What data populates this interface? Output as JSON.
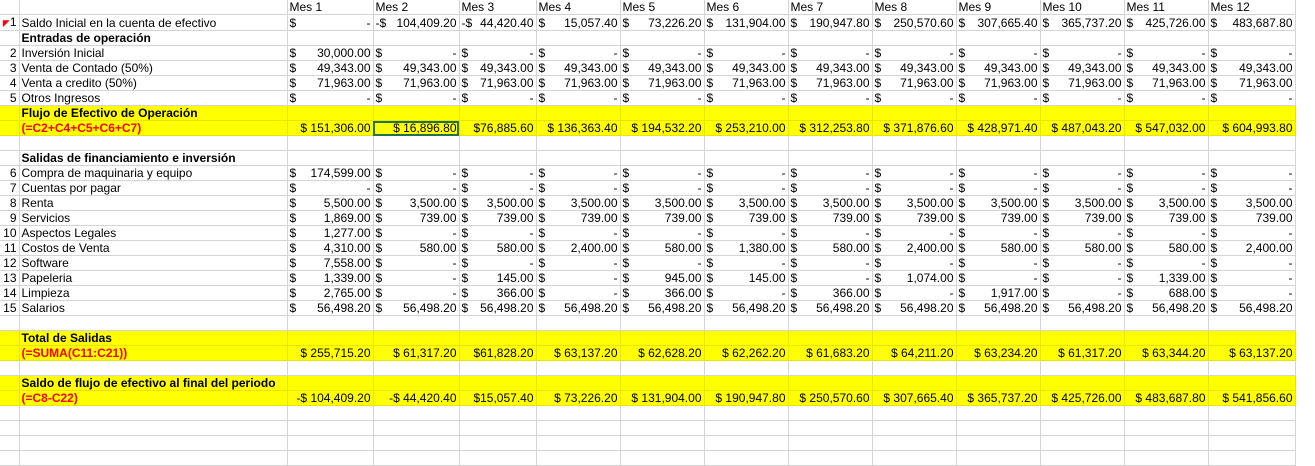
{
  "months": [
    "Mes 1",
    "Mes 2",
    "Mes 3",
    "Mes 4",
    "Mes 5",
    "Mes 6",
    "Mes 7",
    "Mes 8",
    "Mes 9",
    "Mes 10",
    "Mes 11",
    "Mes 12"
  ],
  "rows": [
    {
      "type": "header"
    },
    {
      "type": "data",
      "num": "1",
      "label": "Saldo Inicial en la cuenta de efectivo",
      "cells": [
        [
          "$",
          "-"
        ],
        [
          "-$",
          "104,409.20"
        ],
        [
          "-$",
          "44,420.40"
        ],
        [
          "$",
          "15,057.40"
        ],
        [
          "$",
          "73,226.20"
        ],
        [
          "$",
          "131,904.00"
        ],
        [
          "$",
          "190,947.80"
        ],
        [
          "$",
          "250,570.60"
        ],
        [
          "$",
          "307,665.40"
        ],
        [
          "$",
          "365,737.20"
        ],
        [
          "$",
          "425,726.00"
        ],
        [
          "$",
          "483,687.80"
        ]
      ]
    },
    {
      "type": "section",
      "label": "Entradas de operación"
    },
    {
      "type": "data",
      "num": "2",
      "label": "Inversión Inicial",
      "cells": [
        [
          "$",
          "30,000.00"
        ],
        [
          "$",
          "-"
        ],
        [
          "$",
          "-"
        ],
        [
          "$",
          "-"
        ],
        [
          "$",
          "-"
        ],
        [
          "$",
          "-"
        ],
        [
          "$",
          "-"
        ],
        [
          "$",
          "-"
        ],
        [
          "$",
          "-"
        ],
        [
          "$",
          "-"
        ],
        [
          "$",
          "-"
        ],
        [
          "$",
          "-"
        ]
      ]
    },
    {
      "type": "data",
      "num": "3",
      "label": "Venta de Contado (50%)",
      "cells": [
        [
          "$",
          "49,343.00"
        ],
        [
          "$",
          "49,343.00"
        ],
        [
          "$",
          "49,343.00"
        ],
        [
          "$",
          "49,343.00"
        ],
        [
          "$",
          "49,343.00"
        ],
        [
          "$",
          "49,343.00"
        ],
        [
          "$",
          "49,343.00"
        ],
        [
          "$",
          "49,343.00"
        ],
        [
          "$",
          "49,343.00"
        ],
        [
          "$",
          "49,343.00"
        ],
        [
          "$",
          "49,343.00"
        ],
        [
          "$",
          "49,343.00"
        ]
      ]
    },
    {
      "type": "data",
      "num": "4",
      "label": "Venta a credito (50%)",
      "cells": [
        [
          "$",
          "71,963.00"
        ],
        [
          "$",
          "71,963.00"
        ],
        [
          "$",
          "71,963.00"
        ],
        [
          "$",
          "71,963.00"
        ],
        [
          "$",
          "71,963.00"
        ],
        [
          "$",
          "71,963.00"
        ],
        [
          "$",
          "71,963.00"
        ],
        [
          "$",
          "71,963.00"
        ],
        [
          "$",
          "71,963.00"
        ],
        [
          "$",
          "71,963.00"
        ],
        [
          "$",
          "71,963.00"
        ],
        [
          "$",
          "71,963.00"
        ]
      ]
    },
    {
      "type": "data",
      "num": "5",
      "label": "Otros Ingresos",
      "cells": [
        [
          "$",
          "-"
        ],
        [
          "$",
          "-"
        ],
        [
          "$",
          "-"
        ],
        [
          "$",
          "-"
        ],
        [
          "$",
          "-"
        ],
        [
          "$",
          "-"
        ],
        [
          "$",
          "-"
        ],
        [
          "$",
          "-"
        ],
        [
          "$",
          "-"
        ],
        [
          "$",
          "-"
        ],
        [
          "$",
          "-"
        ],
        [
          "$",
          "-"
        ]
      ]
    },
    {
      "type": "hl1",
      "label": "Flujo de Efectivo de Operación"
    },
    {
      "type": "hl2",
      "label": "(=C2+C4+C5+C6+C7)",
      "cells": [
        "$ 151,306.00",
        "$   16,896.80",
        "$76,885.60",
        "$ 136,363.40",
        "$ 194,532.20",
        "$ 253,210.00",
        "$ 312,253.80",
        "$ 371,876.60",
        "$ 428,971.40",
        "$ 487,043.20",
        "$ 547,032.00",
        "$ 604,993.80"
      ]
    },
    {
      "type": "blank"
    },
    {
      "type": "section",
      "label": "Salidas de financiamiento e inversión"
    },
    {
      "type": "data",
      "num": "6",
      "label": "Compra de maquinaria y equipo",
      "cells": [
        [
          "$",
          "174,599.00"
        ],
        [
          "$",
          "-"
        ],
        [
          "$",
          "-"
        ],
        [
          "$",
          "-"
        ],
        [
          "$",
          "-"
        ],
        [
          "$",
          "-"
        ],
        [
          "$",
          "-"
        ],
        [
          "$",
          "-"
        ],
        [
          "$",
          "-"
        ],
        [
          "$",
          "-"
        ],
        [
          "$",
          "-"
        ],
        [
          "$",
          "-"
        ]
      ]
    },
    {
      "type": "data",
      "num": "7",
      "label": "Cuentas por pagar",
      "cells": [
        [
          "$",
          "-"
        ],
        [
          "$",
          "-"
        ],
        [
          "$",
          "-"
        ],
        [
          "$",
          "-"
        ],
        [
          "$",
          "-"
        ],
        [
          "$",
          "-"
        ],
        [
          "$",
          "-"
        ],
        [
          "$",
          "-"
        ],
        [
          "$",
          "-"
        ],
        [
          "$",
          "-"
        ],
        [
          "$",
          "-"
        ],
        [
          "$",
          "-"
        ]
      ]
    },
    {
      "type": "data",
      "num": "8",
      "label": "Renta",
      "cells": [
        [
          "$",
          "5,500.00"
        ],
        [
          "$",
          "3,500.00"
        ],
        [
          "$",
          "3,500.00"
        ],
        [
          "$",
          "3,500.00"
        ],
        [
          "$",
          "3,500.00"
        ],
        [
          "$",
          "3,500.00"
        ],
        [
          "$",
          "3,500.00"
        ],
        [
          "$",
          "3,500.00"
        ],
        [
          "$",
          "3,500.00"
        ],
        [
          "$",
          "3,500.00"
        ],
        [
          "$",
          "3,500.00"
        ],
        [
          "$",
          "3,500.00"
        ]
      ]
    },
    {
      "type": "data",
      "num": "9",
      "label": "Servicios",
      "cells": [
        [
          "$",
          "1,869.00"
        ],
        [
          "$",
          "739.00"
        ],
        [
          "$",
          "739.00"
        ],
        [
          "$",
          "739.00"
        ],
        [
          "$",
          "739.00"
        ],
        [
          "$",
          "739.00"
        ],
        [
          "$",
          "739.00"
        ],
        [
          "$",
          "739.00"
        ],
        [
          "$",
          "739.00"
        ],
        [
          "$",
          "739.00"
        ],
        [
          "$",
          "739.00"
        ],
        [
          "$",
          "739.00"
        ]
      ]
    },
    {
      "type": "data",
      "num": "10",
      "label": "Aspectos Legales",
      "cells": [
        [
          "$",
          "1,277.00"
        ],
        [
          "$",
          "-"
        ],
        [
          "$",
          "-"
        ],
        [
          "$",
          "-"
        ],
        [
          "$",
          "-"
        ],
        [
          "$",
          "-"
        ],
        [
          "$",
          "-"
        ],
        [
          "$",
          "-"
        ],
        [
          "$",
          "-"
        ],
        [
          "$",
          "-"
        ],
        [
          "$",
          "-"
        ],
        [
          "$",
          "-"
        ]
      ]
    },
    {
      "type": "data",
      "num": "11",
      "label": "Costos de Venta",
      "cells": [
        [
          "$",
          "4,310.00"
        ],
        [
          "$",
          "580.00"
        ],
        [
          "$",
          "580.00"
        ],
        [
          "$",
          "2,400.00"
        ],
        [
          "$",
          "580.00"
        ],
        [
          "$",
          "1,380.00"
        ],
        [
          "$",
          "580.00"
        ],
        [
          "$",
          "2,400.00"
        ],
        [
          "$",
          "580.00"
        ],
        [
          "$",
          "580.00"
        ],
        [
          "$",
          "580.00"
        ],
        [
          "$",
          "2,400.00"
        ]
      ]
    },
    {
      "type": "data",
      "num": "12",
      "label": "Software",
      "cells": [
        [
          "$",
          "7,558.00"
        ],
        [
          "$",
          "-"
        ],
        [
          "$",
          "-"
        ],
        [
          "$",
          "-"
        ],
        [
          "$",
          "-"
        ],
        [
          "$",
          "-"
        ],
        [
          "$",
          "-"
        ],
        [
          "$",
          "-"
        ],
        [
          "$",
          "-"
        ],
        [
          "$",
          "-"
        ],
        [
          "$",
          "-"
        ],
        [
          "$",
          "-"
        ]
      ]
    },
    {
      "type": "data",
      "num": "13",
      "label": "Papeleria",
      "cells": [
        [
          "$",
          "1,339.00"
        ],
        [
          "$",
          "-"
        ],
        [
          "$",
          "145.00"
        ],
        [
          "$",
          "-"
        ],
        [
          "$",
          "945.00"
        ],
        [
          "$",
          "145.00"
        ],
        [
          "$",
          "-"
        ],
        [
          "$",
          "1,074.00"
        ],
        [
          "$",
          "-"
        ],
        [
          "$",
          "-"
        ],
        [
          "$",
          "1,339.00"
        ],
        [
          "$",
          "-"
        ]
      ]
    },
    {
      "type": "data",
      "num": "14",
      "label": "Limpieza",
      "cells": [
        [
          "$",
          "2,765.00"
        ],
        [
          "$",
          "-"
        ],
        [
          "$",
          "366.00"
        ],
        [
          "$",
          "-"
        ],
        [
          "$",
          "366.00"
        ],
        [
          "$",
          "-"
        ],
        [
          "$",
          "366.00"
        ],
        [
          "$",
          "-"
        ],
        [
          "$",
          "1,917.00"
        ],
        [
          "$",
          "-"
        ],
        [
          "$",
          "688.00"
        ],
        [
          "$",
          "-"
        ]
      ]
    },
    {
      "type": "data",
      "num": "15",
      "label": "Salarios",
      "cells": [
        [
          "$",
          "56,498.20"
        ],
        [
          "$",
          "56,498.20"
        ],
        [
          "$",
          "56,498.20"
        ],
        [
          "$",
          "56,498.20"
        ],
        [
          "$",
          "56,498.20"
        ],
        [
          "$",
          "56,498.20"
        ],
        [
          "$",
          "56,498.20"
        ],
        [
          "$",
          "56,498.20"
        ],
        [
          "$",
          "56,498.20"
        ],
        [
          "$",
          "56,498.20"
        ],
        [
          "$",
          "56,498.20"
        ],
        [
          "$",
          "56,498.20"
        ]
      ]
    },
    {
      "type": "blank"
    },
    {
      "type": "hl1",
      "label": "Total de Salidas"
    },
    {
      "type": "hl2",
      "label": "(=SUMA(C11:C21))",
      "cells": [
        "$ 255,715.20",
        "$   61,317.20",
        "$61,828.20",
        "$   63,137.20",
        "$   62,628.20",
        "$   62,262.20",
        "$   61,683.20",
        "$   64,211.20",
        "$   63,234.20",
        "$   61,317.20",
        "$   63,344.20",
        "$   63,137.20"
      ]
    },
    {
      "type": "blank"
    },
    {
      "type": "hl1",
      "label": "Saldo de flujo de efectivo al final del periodo"
    },
    {
      "type": "hl2",
      "label": "(=C8-C22)",
      "cells": [
        "-$ 104,409.20",
        "-$   44,420.40",
        "$15,057.40",
        "$   73,226.20",
        "$ 131,904.00",
        "$ 190,947.80",
        "$ 250,570.60",
        "$ 307,665.40",
        "$ 365,737.20",
        "$ 425,726.00",
        "$ 483,687.80",
        "$ 541,856.60"
      ]
    },
    {
      "type": "blank"
    },
    {
      "type": "blank"
    },
    {
      "type": "blank"
    },
    {
      "type": "blank"
    }
  ]
}
